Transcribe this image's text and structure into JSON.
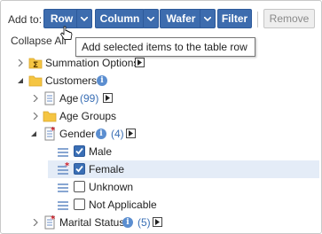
{
  "toolbar": {
    "add_to_label": "Add to:",
    "row_label": "Row",
    "column_label": "Column",
    "wafer_label": "Wafer",
    "filter_label": "Filter",
    "remove_label": "Remove"
  },
  "collapse_all_label": "Collapse All",
  "tooltip_text": "Add selected items to the table row",
  "tree": {
    "summation_options": "Summation Options",
    "customers": "Customers",
    "age": "Age",
    "age_count": "(99)",
    "age_groups": "Age Groups",
    "gender": "Gender",
    "gender_count": "(4)",
    "male": "Male",
    "female": "Female",
    "unknown": "Unknown",
    "not_applicable": "Not Applicable",
    "marital_status": "Marital Status",
    "marital_count": "(5)"
  },
  "checks": {
    "male": true,
    "female": true,
    "unknown": false,
    "not_applicable": false
  },
  "colors": {
    "accent": "#3d6cae",
    "selected_row": "#e4ecf7",
    "count_text": "#3a6fb5",
    "folder": "#f5c542"
  }
}
